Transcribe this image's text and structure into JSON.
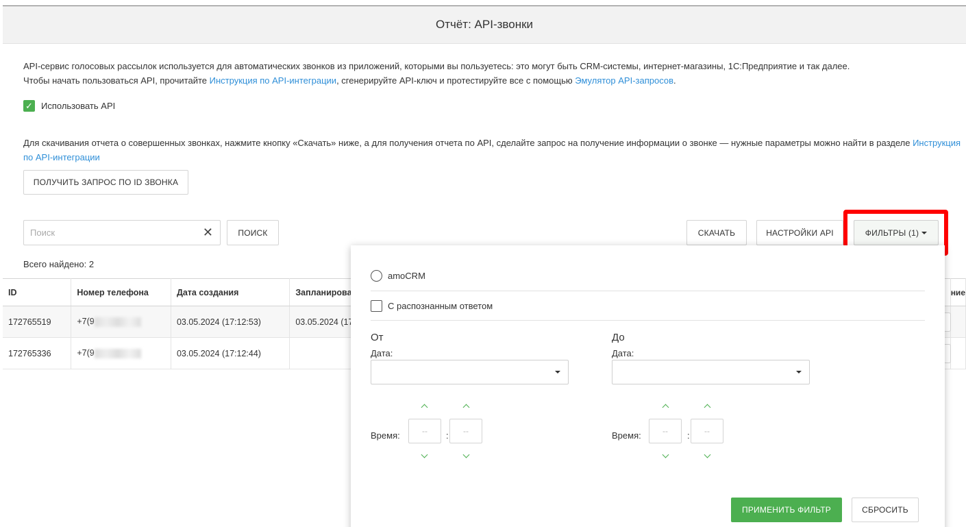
{
  "header": {
    "title": "Отчёт: API-звонки"
  },
  "intro": {
    "line1": "API-сервис голосовых рассылок используется для автоматических звонков из приложений, которыми вы пользуетесь: это могут быть CRM-системы, интернет-магазины, 1С:Предприятие и так далее.",
    "line2_pre": "Чтобы начать пользоваться API, прочитайте ",
    "link_instruction": "Инструкция по API-интеграции",
    "line2_mid": ", сгенерируйте API-ключ и протестируйте все с помощью ",
    "link_emulator": "Эмулятор API-запросов",
    "line2_post": "."
  },
  "use_api": {
    "label": "Использовать API",
    "checked": true
  },
  "download_info": {
    "text": "Для скачивания отчета о совершенных звонках, нажмите кнопку «Скачать» ниже, а для получения отчета по API, сделайте запрос на получение информации о звонке — нужные параметры можно найти в разделе ",
    "link": "Инструкция по API-интеграции"
  },
  "buttons": {
    "get_by_id": "ПОЛУЧИТЬ ЗАПРОС ПО ID ЗВОНКА",
    "search": "ПОИСК",
    "download": "СКАЧАТЬ",
    "api_settings": "НАСТРОЙКИ API",
    "filters": "ФИЛЬТРЫ (1)"
  },
  "search": {
    "placeholder": "Поиск",
    "value": ""
  },
  "total": "Всего найдено: 2",
  "table": {
    "columns": [
      "ID",
      "Номер телефона",
      "Дата создания",
      "Запланирован",
      "ние"
    ],
    "rows": [
      {
        "id": "172765519",
        "phone": "+7(9",
        "created": "03.05.2024 (17:12:53)",
        "scheduled": "03.05.2024 (17"
      },
      {
        "id": "172765336",
        "phone": "+7(9",
        "created": "03.05.2024 (17:12:44)",
        "scheduled": ""
      }
    ]
  },
  "filters": {
    "amocrm_label": "amoCRM",
    "recognized_label": "С распознанным ответом",
    "from": {
      "title": "От",
      "date_label": "Дата:",
      "time_label": "Время:",
      "hours": "--",
      "minutes": "--",
      "colon": ":"
    },
    "to": {
      "title": "До",
      "date_label": "Дата:",
      "time_label": "Время:",
      "hours": "--",
      "minutes": "--",
      "colon": ":"
    },
    "apply": "ПРИМЕНИТЬ ФИЛЬТР",
    "reset": "СБРОСИТЬ"
  },
  "colors": {
    "accent_green": "#4caf50",
    "link_blue": "#2f8fd8",
    "highlight_red": "#ff0000"
  }
}
